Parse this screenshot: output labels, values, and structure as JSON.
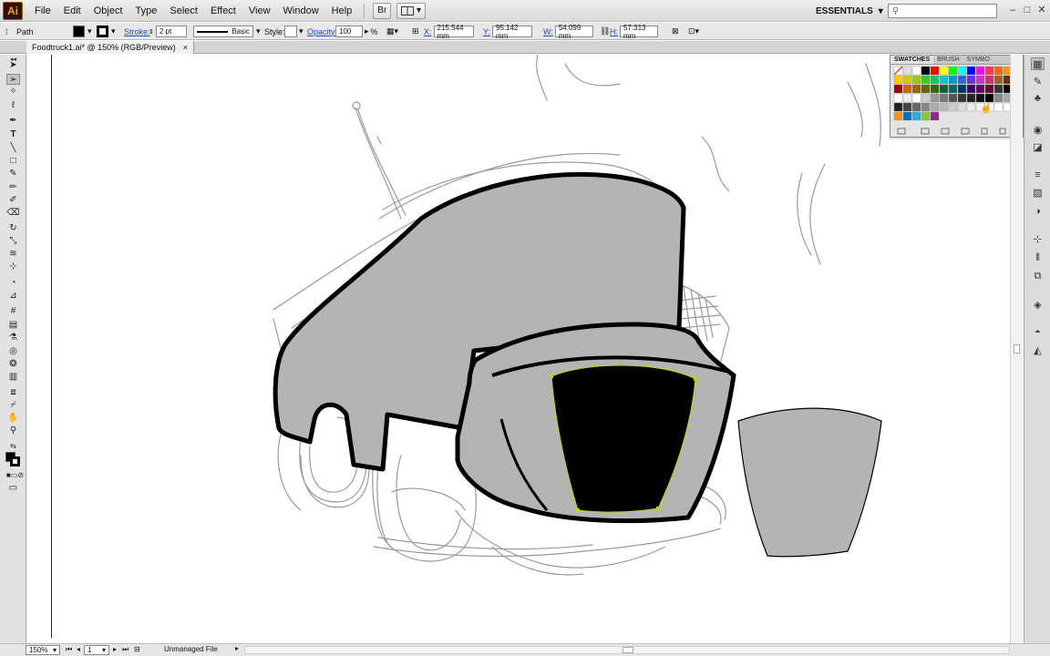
{
  "app": {
    "logo": "Ai"
  },
  "menubar": {
    "items": [
      "File",
      "Edit",
      "Object",
      "Type",
      "Select",
      "Effect",
      "View",
      "Window",
      "Help"
    ],
    "bridge_label": "Br",
    "workspace": "ESSENTIALS",
    "search_placeholder": ""
  },
  "controlbar": {
    "selection_type": "Path",
    "stroke_label": "Stroke:",
    "stroke_value": "2 pt",
    "brush_label": "Basic",
    "style_label": "Style:",
    "opacity_label": "Opacity:",
    "opacity_value": "100",
    "opacity_unit": "%",
    "x_label": "X:",
    "x_value": "215.544 mm",
    "y_label": "Y:",
    "y_value": "95.142 mm",
    "w_label": "W:",
    "w_value": "54.099 mm",
    "h_label": "H:",
    "h_value": "57.313 mm"
  },
  "document": {
    "tab_title": "Foodtruck1.ai* @ 150% (RGB/Preview)",
    "close": "×"
  },
  "statusbar": {
    "zoom": "150%",
    "artboard": "1",
    "status_text": "Unmanaged File"
  },
  "swatches_panel": {
    "tabs": [
      "SWATCHES",
      "BRUSH",
      "SYMBO"
    ],
    "menu_icon": "»"
  },
  "colors": {
    "fill": "#000000",
    "shape_fill": "#b4b4b4",
    "selection": "#c8d400",
    "sketch": "#9a9a9a"
  }
}
